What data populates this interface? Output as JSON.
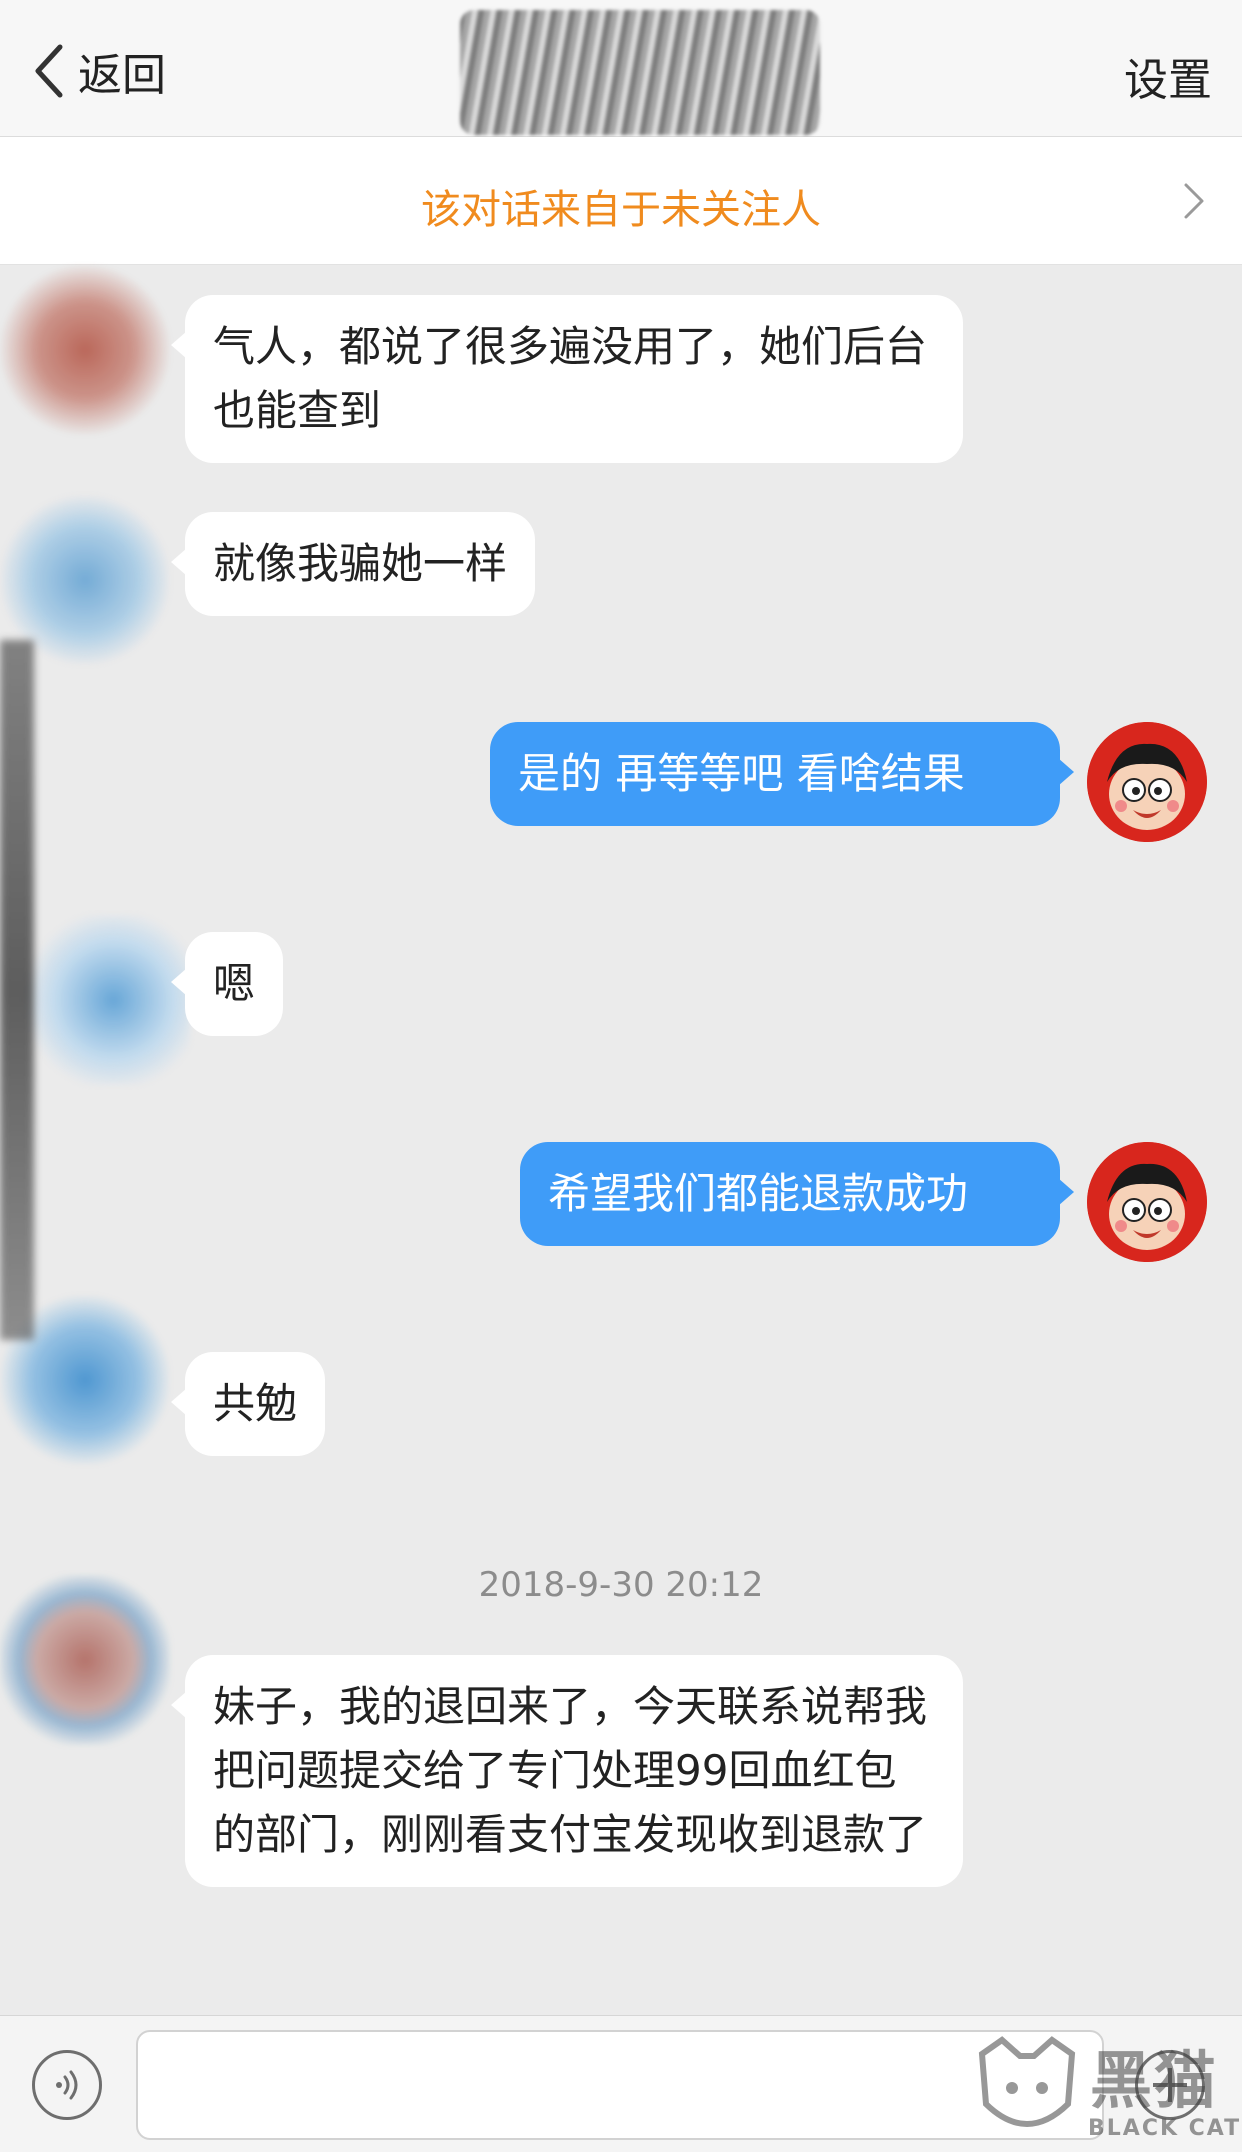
{
  "nav": {
    "back_label": "返回",
    "settings_label": "设置"
  },
  "banner": {
    "text": "该对话来自于未关注人"
  },
  "messages": [
    {
      "side": "in",
      "text": "气人，都说了很多遍没用了，她们后台也能查到"
    },
    {
      "side": "in",
      "text": "就像我骗她一样"
    },
    {
      "side": "out",
      "text": "是的 再等等吧 看啥结果"
    },
    {
      "side": "in",
      "text": "嗯"
    },
    {
      "side": "out",
      "text": "希望我们都能退款成功"
    },
    {
      "side": "in",
      "text": "共勉"
    },
    {
      "side": "in",
      "text": "妹子，我的退回来了，今天联系说帮我把问题提交给了专门处理99回血红包的部门，刚刚看支付宝发现收到退款了"
    }
  ],
  "timestamp": "2018-9-30 20:12",
  "input": {
    "placeholder": ""
  },
  "watermark": {
    "cn": "黑猫",
    "en": "BLACK CAT"
  },
  "colors": {
    "accent_out": "#3f9cf8",
    "banner_text": "#f08b1e",
    "background": "#ebebeb"
  },
  "icons": [
    "chevron-left-icon",
    "chevron-right-icon",
    "voice-icon",
    "plus-icon",
    "avatar-icon"
  ]
}
